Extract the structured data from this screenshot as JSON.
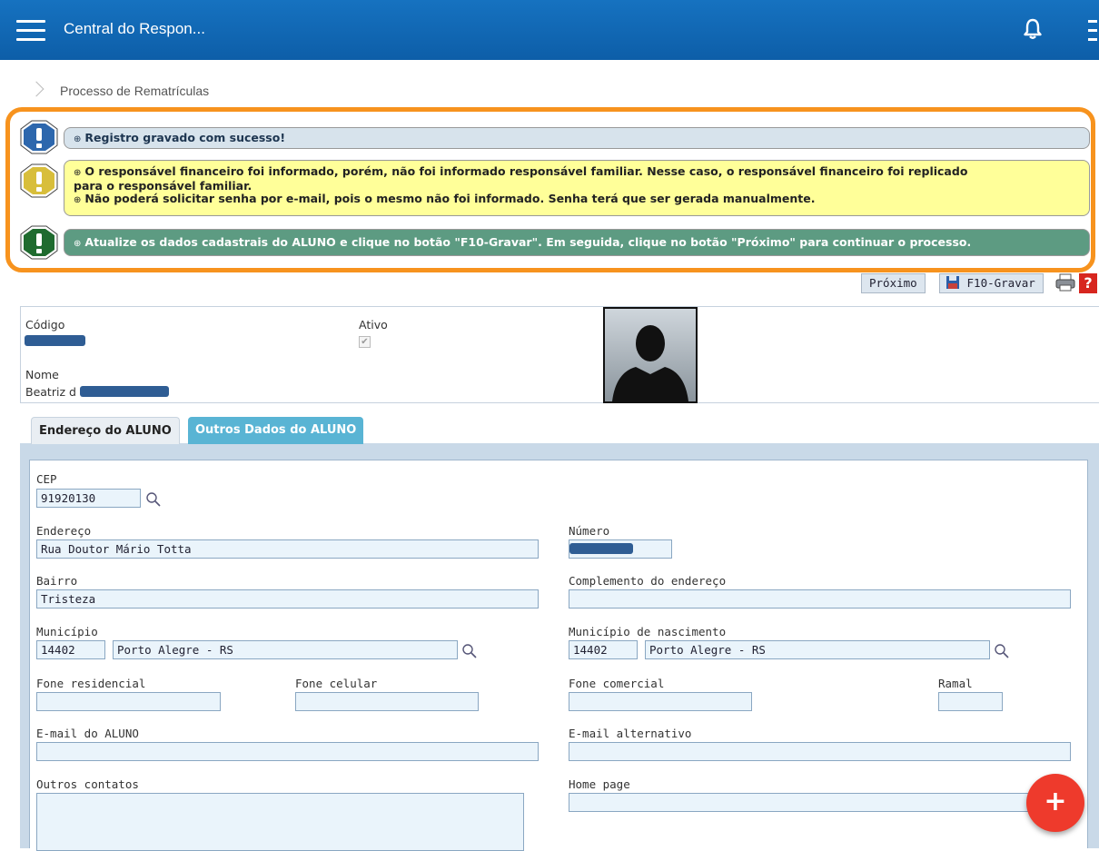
{
  "header": {
    "title": "Central do Respon...",
    "menu_icon": "hamburger-menu-icon",
    "notifications_icon": "bell-icon",
    "more_icon": "kebab-menu-icon"
  },
  "breadcrumb": {
    "current": "Processo de Rematrículas"
  },
  "messages": {
    "info": "Registro gravado com sucesso!",
    "warning_lines": [
      "O responsável financeiro foi informado, porém, não foi informado responsável familiar. Nesse caso, o responsável financeiro foi replicado",
      "para o responsável familiar.",
      "Não poderá solicitar senha por e-mail, pois o mesmo não foi informado. Senha terá que ser gerada manualmente."
    ],
    "success": "Atualize os dados cadastrais do ALUNO e clique no botão \"F10-Gravar\". Em seguida, clique no botão \"Próximo\" para continuar o processo."
  },
  "toolbar": {
    "next_label": "Próximo",
    "save_label": "F10-Gravar"
  },
  "record": {
    "code_label": "Código",
    "active_label": "Ativo",
    "name_label": "Nome",
    "name_value": "Beatriz d",
    "active_checked": true
  },
  "tabs": [
    {
      "label": "Endereço do ALUNO",
      "active": true
    },
    {
      "label": "Outros Dados do ALUNO",
      "active": false
    }
  ],
  "form": {
    "cep_label": "CEP",
    "cep_value": "91920130",
    "endereco_label": "Endereço",
    "endereco_value": "Rua Doutor Mário Totta",
    "numero_label": "Número",
    "bairro_label": "Bairro",
    "bairro_value": "Tristeza",
    "complemento_label": "Complemento do endereço",
    "complemento_value": "",
    "municipio_label": "Município",
    "municipio_code": "14402",
    "municipio_name": "Porto Alegre - RS",
    "municipio_nasc_label": "Município de nascimento",
    "municipio_nasc_code": "14402",
    "municipio_nasc_name": "Porto Alegre - RS",
    "fone_res_label": "Fone residencial",
    "fone_cel_label": "Fone celular",
    "fone_com_label": "Fone comercial",
    "ramal_label": "Ramal",
    "email_label": "E-mail do ALUNO",
    "email_alt_label": "E-mail alternativo",
    "outros_label": "Outros contatos",
    "homepage_label": "Home page"
  },
  "fab": {
    "label": "+"
  },
  "colors": {
    "topbar": "#0d5ea8",
    "highlight": "#f7931e",
    "info_bar": "#d7e3ec",
    "warning_bar": "#ffff99",
    "success_bar": "#5d9b82",
    "fab": "#ee3a2c"
  }
}
